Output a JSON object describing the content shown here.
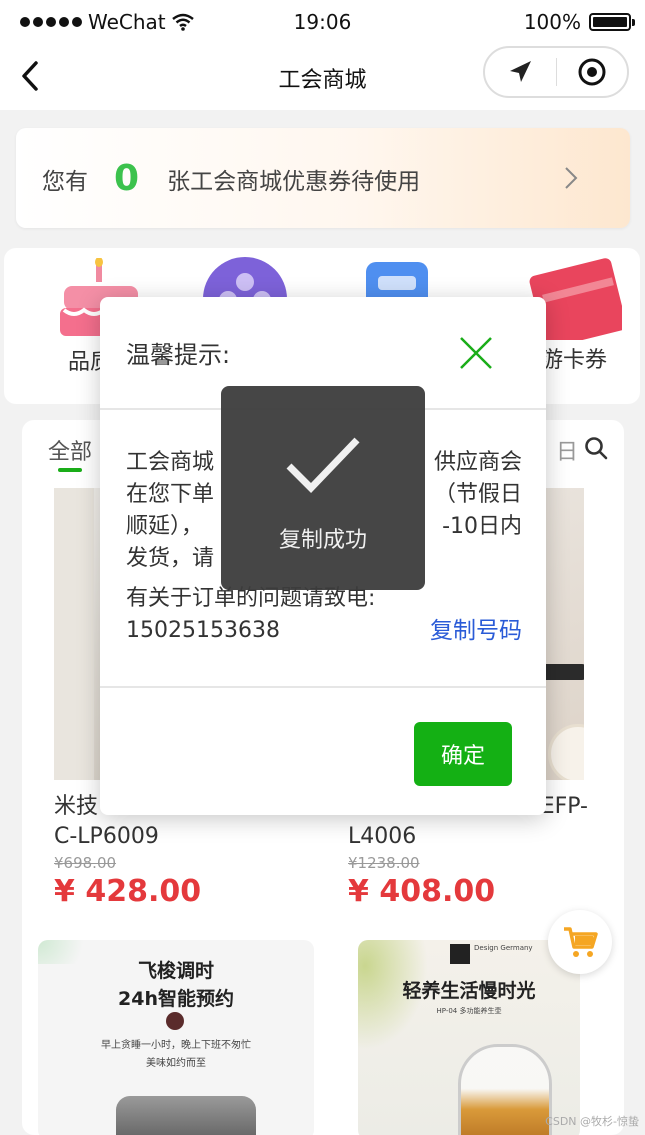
{
  "status_bar": {
    "carrier": "WeChat",
    "time": "19:06",
    "battery": "100%"
  },
  "nav": {
    "title": "工会商城"
  },
  "coupon": {
    "prefix": "您有",
    "count": "0",
    "suffix": "张工会商城优惠券待使用"
  },
  "categories": [
    {
      "label": "品质蛋"
    },
    {
      "label": ""
    },
    {
      "label": ""
    },
    {
      "label": "游卡券"
    }
  ],
  "tabs": {
    "active": "全部",
    "right_partial": "日"
  },
  "products": [
    {
      "name": "米技",
      "name2": "C-LP6009",
      "orig_price": "¥698.00",
      "price": "¥ 428.00"
    },
    {
      "name": "EFP-",
      "name2": "L4006",
      "orig_price": "¥1238.00",
      "price": "¥ 408.00"
    }
  ],
  "product_images": {
    "left_heading1": "飞梭调时",
    "left_heading2": "24h智能预约",
    "left_line1": "早上贪睡一小时，晚上下班不匆忙",
    "left_line2": "美味如约而至",
    "right_heading": "轻养生活慢时光",
    "right_sub": "HP-04 多功能养生壶",
    "right_brand": "Design Germany"
  },
  "modal": {
    "title": "温馨提示:",
    "text_line1_a": "工会商城",
    "text_line1_b": "供应商会",
    "text_line2_a": "在您下单",
    "text_line2_b": "（节假日",
    "text_line3_a": "顺延），",
    "text_line3_b": "-10日内",
    "text_line4_a": "发货，请",
    "contact_label": "有关于订单的问题请致电:",
    "phone": "15025153638",
    "copy_label": "复制号码",
    "confirm_label": "确定"
  },
  "toast": {
    "text": "复制成功"
  },
  "watermark": "CSDN @牧杉-惊蛰",
  "colors": {
    "accent": "#14b014",
    "price": "#e4393c",
    "link": "#2a5bd7",
    "toast_bg": "#3c3c3c"
  }
}
